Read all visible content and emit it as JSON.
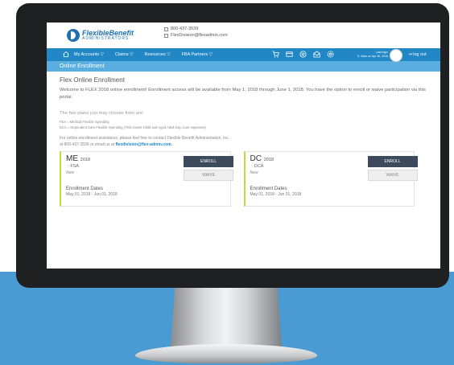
{
  "header": {
    "logo": {
      "main": "FlexibleBenefit",
      "sub": "ADMINISTRATORS"
    },
    "contact": {
      "phone": "800-437-3539",
      "email": "FlexDivision@flexadmin.com"
    }
  },
  "nav": {
    "items": [
      {
        "label": "My Accounts ▽"
      },
      {
        "label": "Claims ▽"
      },
      {
        "label": "Resources ▽"
      },
      {
        "label": "FBA Partners ▽"
      }
    ],
    "icons": [
      "cart-icon",
      "card-icon",
      "lifebuoy-icon",
      "mail-icon",
      "gear-icon"
    ],
    "last_login_label": "Last login",
    "last_login_value": "S. Klam on Apr 30, 2018",
    "logout_label": "log out"
  },
  "subbar": {
    "title": "Online Enrollment"
  },
  "main": {
    "heading": "Flex Online Enrollment",
    "welcome": "Welcome to FLEX 2018 online enrollment! Enrollment access will be available from May 1, 2018 through June 1, 2018. You have the option to enroll or waive participation via this portal.",
    "plans_heading": "The two plans you may choose from are:",
    "plan_defs": [
      "FSA = Medical Flexible Spending",
      "DCA = Dependent Care Flexible Spending (This covers Child and Aged Adult Day Care expenses)"
    ],
    "assist_line1": "For online enrollment assistance, please feel free to contact Flexible Benefit Administration, Inc.",
    "assist_line2_prefix": "at 800-437-3539 or email us at",
    "assist_email": "flexdivision@flex-admin.com."
  },
  "cards": [
    {
      "code": "ME",
      "year": "2018",
      "type": "- FSA",
      "status": "New",
      "dates_label": "Enrollment Dates",
      "dates": "May 01, 2018 - Jun 01, 2018",
      "enroll_label": "ENROLL",
      "waive_label": "WAIVE"
    },
    {
      "code": "DC",
      "year": "2018",
      "type": "- DCA",
      "status": "New",
      "dates_label": "Enrollment Dates",
      "dates": "May 01, 2018 - Jun 01, 2018",
      "enroll_label": "ENROLL",
      "waive_label": "WAIVE"
    }
  ],
  "colors": {
    "nav": "#2287c5",
    "subbar": "#5aaee0",
    "card_accent": "#c8d83a",
    "enroll_button": "#3d4a5c",
    "backdrop": "#4a9bd3"
  }
}
